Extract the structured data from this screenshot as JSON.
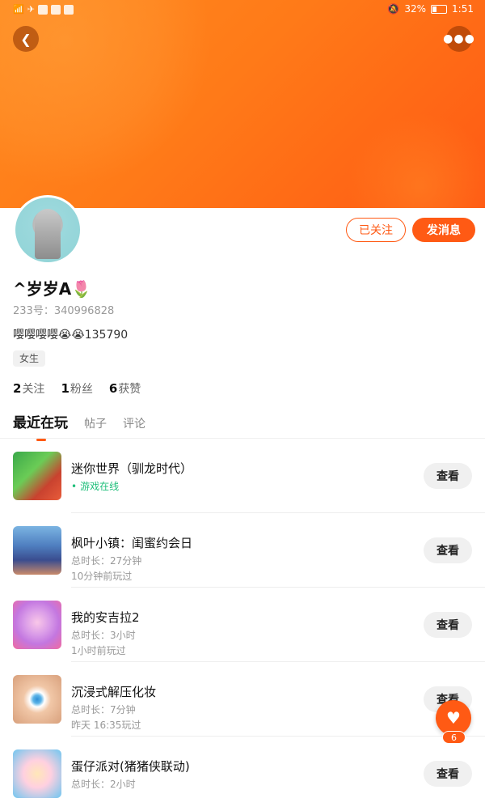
{
  "status_bar": {
    "battery": "32%",
    "time": "1:51"
  },
  "header": {
    "back_icon": "chevron-left-icon",
    "more_icon": "more-dots-icon"
  },
  "profile": {
    "nickname": "^岁岁A🌷",
    "uid": "233号：340996828",
    "bio": "嘤嘤嘤嘤😭😭135790",
    "gender": "女生",
    "follow_label": "已关注",
    "message_label": "发消息"
  },
  "stats": {
    "following": {
      "count": "2",
      "label": "关注"
    },
    "fans": {
      "count": "1",
      "label": "粉丝"
    },
    "likes": {
      "count": "6",
      "label": "获赞"
    }
  },
  "tabs": [
    "最近在玩",
    "帖子",
    "评论"
  ],
  "games": [
    {
      "name": "迷你世界（驯龙时代）",
      "line1": "游戏在线",
      "line2": "",
      "view": "查看"
    },
    {
      "name": "枫叶小镇：闺蜜约会日",
      "line1": "总时长：27分钟",
      "line2": "10分钟前玩过",
      "view": "查看"
    },
    {
      "name": "我的安吉拉2",
      "line1": "总时长：3小时",
      "line2": "1小时前玩过",
      "view": "查看"
    },
    {
      "name": "沉浸式解压化妆",
      "line1": "总时长：7分钟",
      "line2": "昨天 16:35玩过",
      "view": "查看"
    },
    {
      "name": "蛋仔派对(猪猪侠联动)",
      "line1": "总时长：2小时",
      "line2": "",
      "view": "查看"
    }
  ],
  "fab": {
    "icon": "heart-icon",
    "count": "6"
  },
  "colors": {
    "accent": "#ff5a14",
    "online": "#1fbf7a"
  }
}
